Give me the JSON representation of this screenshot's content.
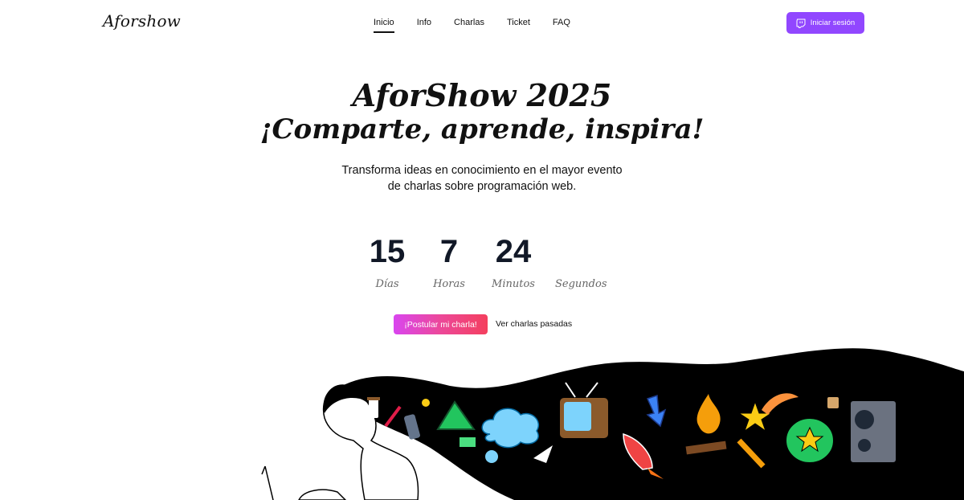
{
  "header": {
    "logo": "Aforshow",
    "nav": [
      {
        "label": "Inicio",
        "active": true
      },
      {
        "label": "Info",
        "active": false
      },
      {
        "label": "Charlas",
        "active": false
      },
      {
        "label": "Ticket",
        "active": false
      },
      {
        "label": "FAQ",
        "active": false
      }
    ],
    "login_label": "Iniciar sesión",
    "login_icon": "twitch-icon"
  },
  "hero": {
    "title": "AforShow 2025",
    "subtitle": "¡Comparte, aprende, inspira!",
    "description_line1": "Transforma ideas en conocimiento en el mayor evento",
    "description_line2": "de charlas sobre programación web."
  },
  "countdown": [
    {
      "value": "15",
      "label": "Días"
    },
    {
      "value": "7",
      "label": "Horas"
    },
    {
      "value": "24",
      "label": "Minutos"
    },
    {
      "value": "",
      "label": "Segundos"
    }
  ],
  "actions": {
    "primary_label": "¡Postular mi charla!",
    "secondary_label": "Ver charlas pasadas"
  },
  "colors": {
    "accent": "#9147ff",
    "cta_start": "#d946ef",
    "cta_end": "#f43f5e",
    "text": "#111827"
  }
}
